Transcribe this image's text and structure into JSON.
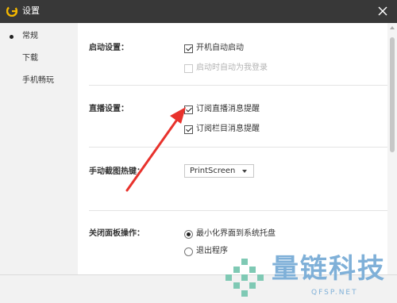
{
  "window": {
    "title": "设置"
  },
  "sidebar": {
    "items": [
      {
        "label": "常规"
      },
      {
        "label": "下载"
      },
      {
        "label": "手机畅玩"
      }
    ]
  },
  "sections": {
    "startup": {
      "label": "启动设置：",
      "options": [
        {
          "label": "开机自动启动",
          "checked": true,
          "enabled": true
        },
        {
          "label": "启动时自动为我登录",
          "checked": false,
          "enabled": false
        }
      ]
    },
    "live": {
      "label": "直播设置：",
      "options": [
        {
          "label": "订阅直播消息提醒",
          "checked": true,
          "enabled": true
        },
        {
          "label": "订阅栏目消息提醒",
          "checked": true,
          "enabled": true
        }
      ]
    },
    "hotkey": {
      "label": "手动截图热键：",
      "value": "PrintScreen"
    },
    "close_panel": {
      "label": "关闭面板操作：",
      "options": [
        {
          "label": "最小化界面到系统托盘",
          "selected": true
        },
        {
          "label": "退出程序",
          "selected": false
        }
      ]
    }
  },
  "watermark": {
    "text": "量链科技",
    "sub": "QFSP.NET"
  },
  "colors": {
    "titlebar": "#383838",
    "sidebar": "#f2f2f2",
    "arrow": "#e8322c",
    "watermark": "#7fb0d8"
  }
}
